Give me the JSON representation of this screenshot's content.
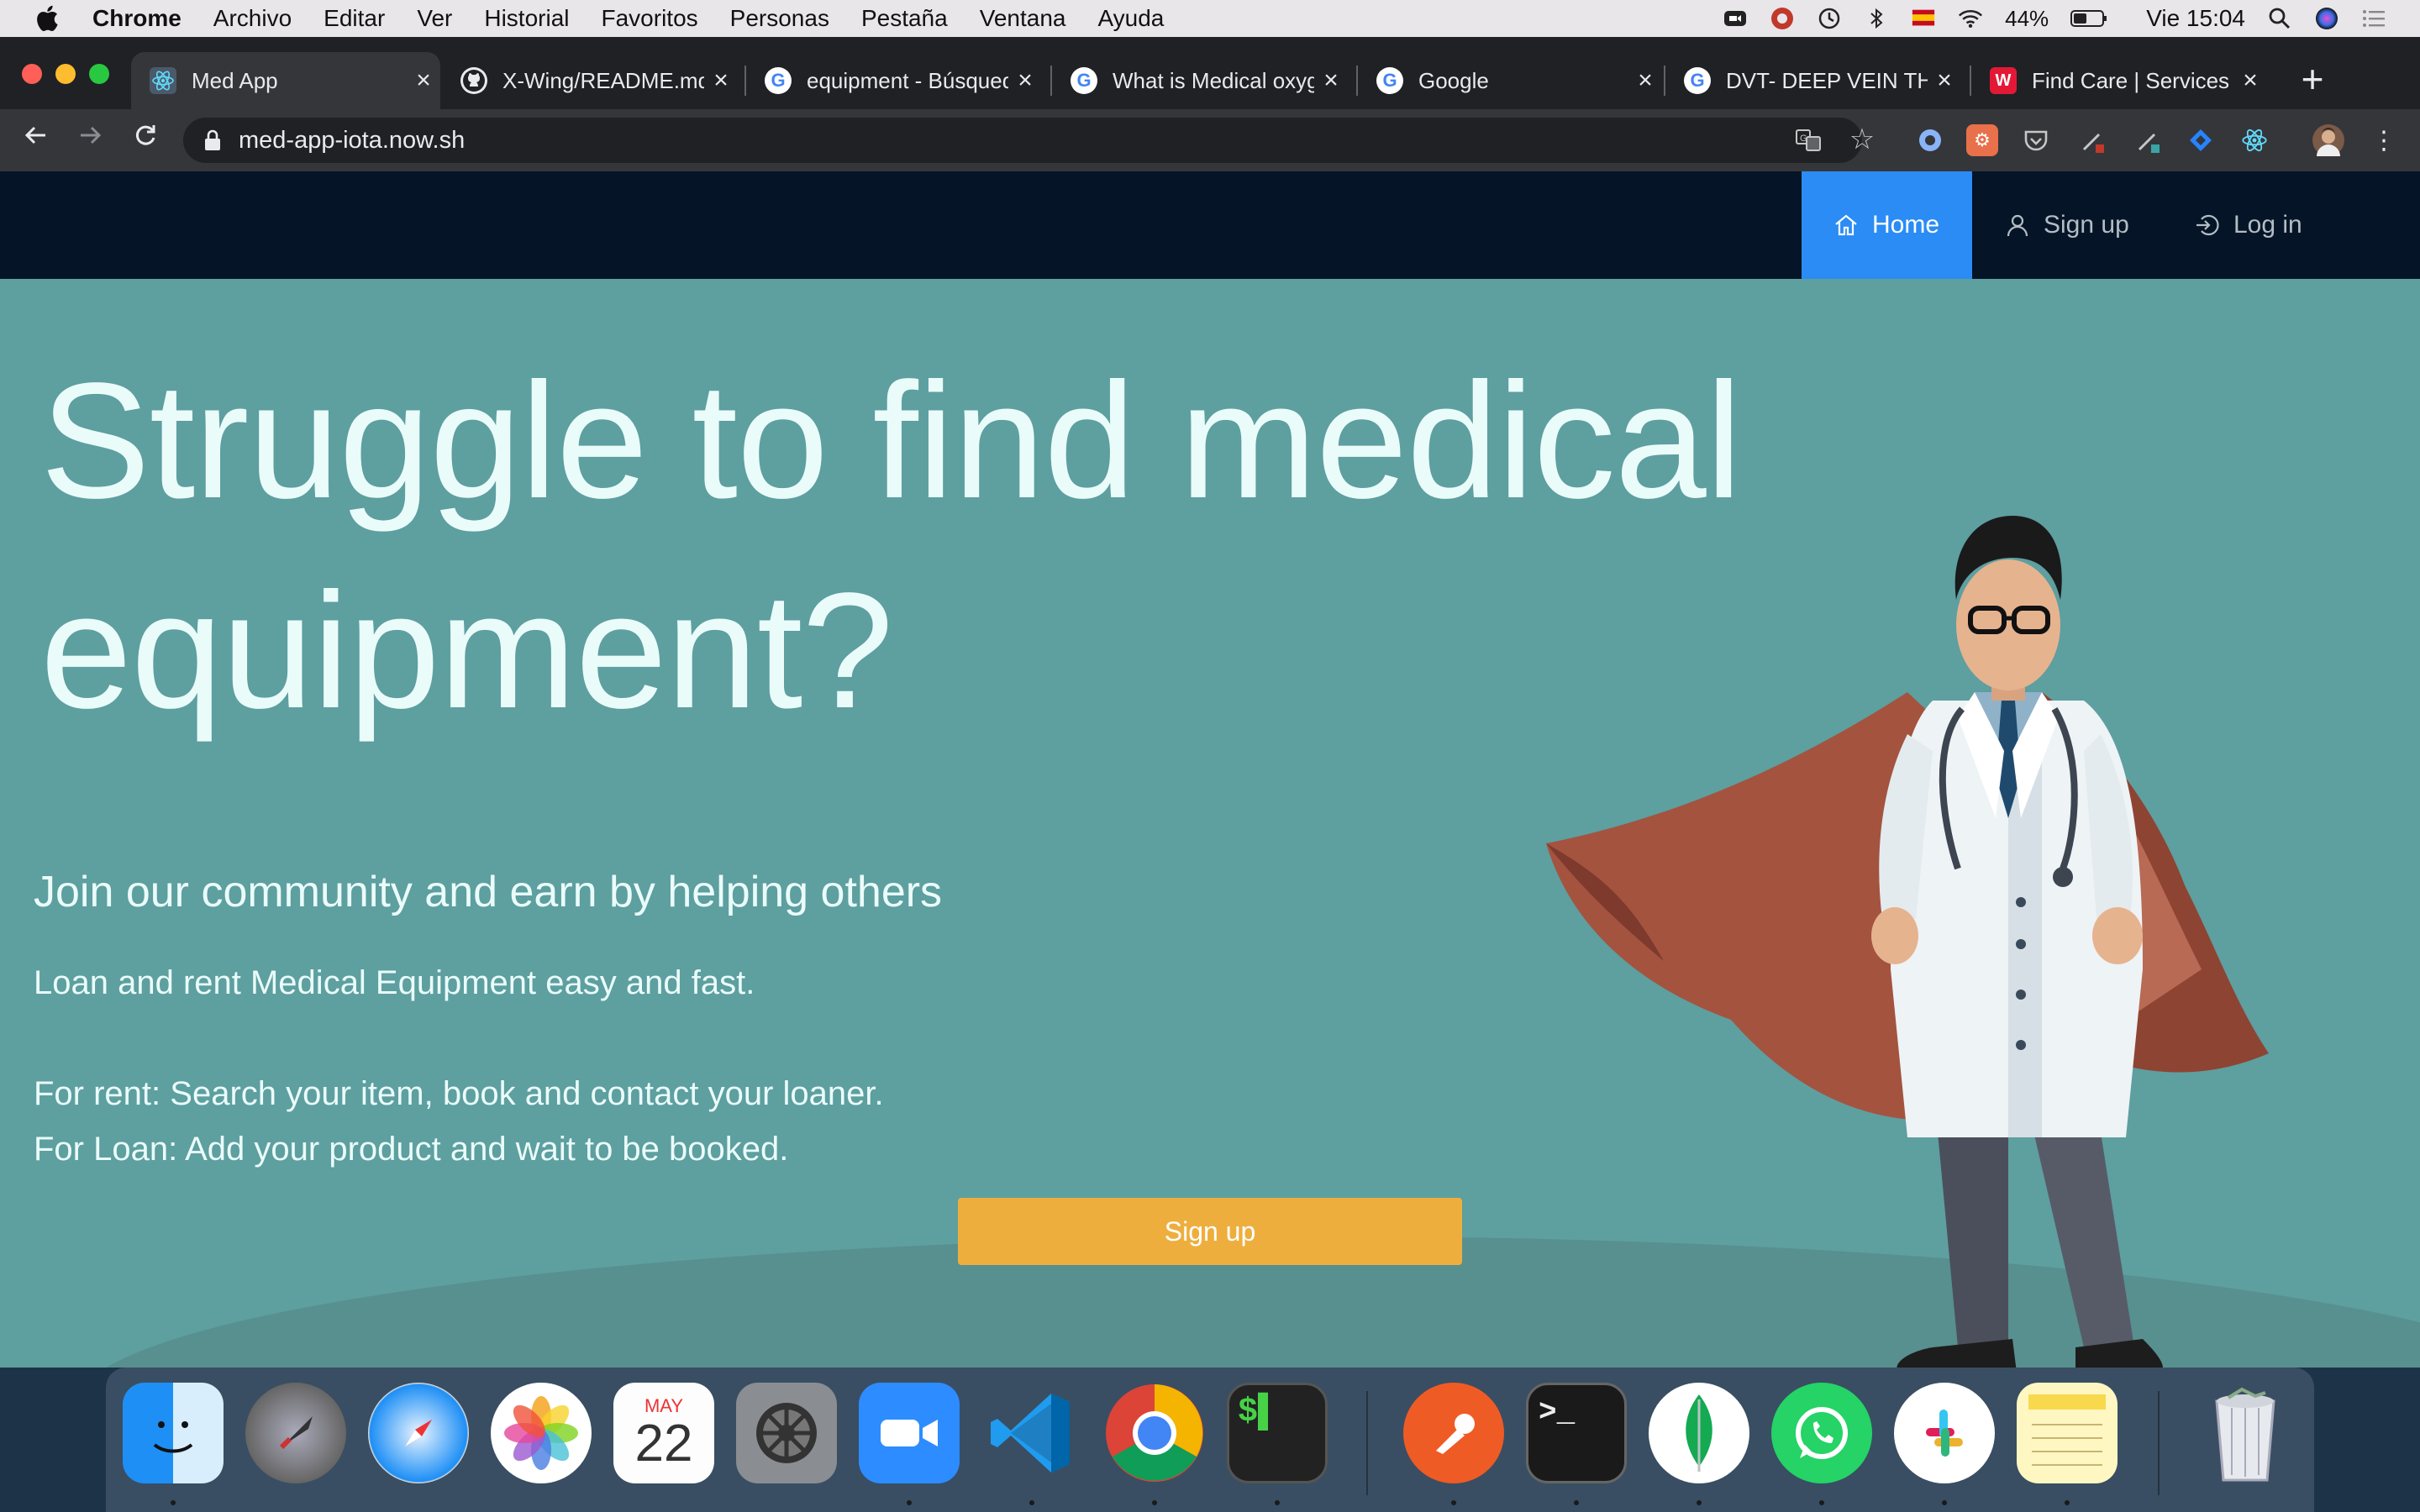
{
  "menubar": {
    "app_name": "Chrome",
    "items": [
      "Archivo",
      "Editar",
      "Ver",
      "Historial",
      "Favoritos",
      "Personas",
      "Pestaña",
      "Ventana",
      "Ayuda"
    ],
    "battery": "44%",
    "clock": "Vie 15:04"
  },
  "tabs": [
    {
      "title": "Med App",
      "favicon": "react-icon",
      "active": true
    },
    {
      "title": "X-Wing/README.md",
      "favicon": "github-icon",
      "active": false
    },
    {
      "title": "equipment - Búsqueda",
      "favicon": "google-icon",
      "active": false
    },
    {
      "title": "What is Medical oxygen",
      "favicon": "google-icon",
      "active": false
    },
    {
      "title": "Google",
      "favicon": "google-icon",
      "active": false
    },
    {
      "title": "DVT- DEEP VEIN THROMBOSIS",
      "favicon": "google-icon",
      "active": false
    },
    {
      "title": "Find Care | Services",
      "favicon": "walgreens-icon",
      "active": false
    }
  ],
  "address": {
    "url": "med-app-iota.now.sh"
  },
  "site": {
    "nav": {
      "home": "Home",
      "signup": "Sign up",
      "login": "Log in"
    },
    "hero": {
      "title_line1": "Struggle to find medical",
      "title_line2": "equipment?",
      "subtitle": "Join our community and earn by helping others",
      "line1": "Loan and rent Medical Equipment easy and fast.",
      "line2": "For rent: Search your item, book and contact your loaner.",
      "line3": "For Loan: Add your product and wait to be booked.",
      "cta": "Sign up"
    },
    "colors": {
      "nav_bg": "#051527",
      "nav_active": "#2a8cf4",
      "hero_bg": "#5e9fa0",
      "cta_bg": "#eeae3e"
    }
  },
  "dock": {
    "apps": [
      "finder-icon",
      "launchpad-icon",
      "safari-icon",
      "photos-icon",
      "calendar-icon",
      "system-preferences-icon",
      "zoom-icon",
      "vscode-icon",
      "chrome-icon",
      "terminal-dollar-icon",
      "postman-icon",
      "terminal-icon",
      "mongodb-icon",
      "whatsapp-icon",
      "slack-icon",
      "notes-icon",
      "trash-icon"
    ],
    "calendar_month": "MAY",
    "calendar_day": "22"
  }
}
